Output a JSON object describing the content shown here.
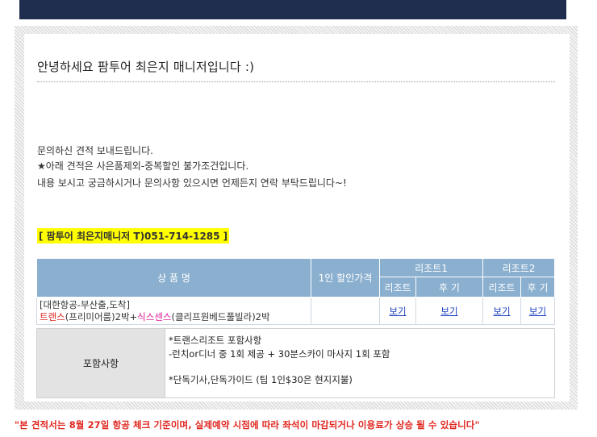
{
  "header": {
    "greeting": "안녕하세요 팜투어 최은지 매니저입니다 :)"
  },
  "message": {
    "line1": "문의하신 견적 보내드립니다.",
    "line2": "★아래 견적은 사은품제외-중복할인 불가조건입니다.",
    "line3": "내용 보시고 궁금하시거나 문의사항 있으시면 언제든지 연락 부탁드립니다~!"
  },
  "contact": "[ 팜투어 최은지매니저 T)051-714-1285 ]",
  "quote_table": {
    "headers": {
      "product": "상 품 명",
      "price": "1인 할인가격",
      "resort1": "리조트1",
      "resort2": "리조트2",
      "resort_col": "리조트",
      "review_col": "후 기"
    },
    "row": {
      "airline": "[대한항공-부산출,도착]",
      "hotel1_name": "트랜스",
      "hotel1_detail": "(프리미어룸)2박+",
      "hotel2_name": "식스센스",
      "hotel2_detail": "(클리프원베드풀빌라)2박",
      "price": "",
      "link": "보기"
    }
  },
  "inclusions": {
    "label": "포함사항",
    "line1": "*트랜스리조트 포함사항",
    "line2": "-런치or디너 중 1회 제공 + 30분스카이 마사지 1회 포함",
    "line3": "*단독기사,단독가이드 (팁 1인$30은 현지지불)"
  },
  "notice": "\"본 견적서는 8월 27일 항공 체크 기준이며, 실제예약 시점에 따라 좌석이 마감되거나 이용료가 상승 될 수 있습니다\"",
  "colors": {
    "topbar": "#1f2d4f",
    "table_header": "#8aafcf",
    "highlight": "#ffff00",
    "notice": "#e0261f",
    "pink": "#e0209a"
  }
}
